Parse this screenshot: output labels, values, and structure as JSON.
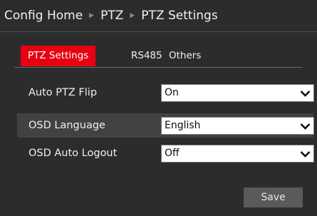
{
  "breadcrumb": {
    "items": [
      "Config Home",
      "PTZ",
      "PTZ Settings"
    ],
    "separator_icon": "triangle-right-icon"
  },
  "tabs": [
    {
      "label": "PTZ Settings",
      "active": true
    },
    {
      "label": "RS485",
      "active": false
    },
    {
      "label": "Others",
      "active": false
    }
  ],
  "settings": [
    {
      "label": "Auto PTZ Flip",
      "value": "On"
    },
    {
      "label": "OSD Language",
      "value": "English"
    },
    {
      "label": "OSD Auto Logout",
      "value": "Off"
    }
  ],
  "dropdown_icon": "chevron-down-icon",
  "actions": {
    "save_label": "Save"
  },
  "colors": {
    "background": "#2c2c2c",
    "active_tab": "#e60012",
    "highlight_row": "#424242",
    "button": "#5a5a5a"
  }
}
